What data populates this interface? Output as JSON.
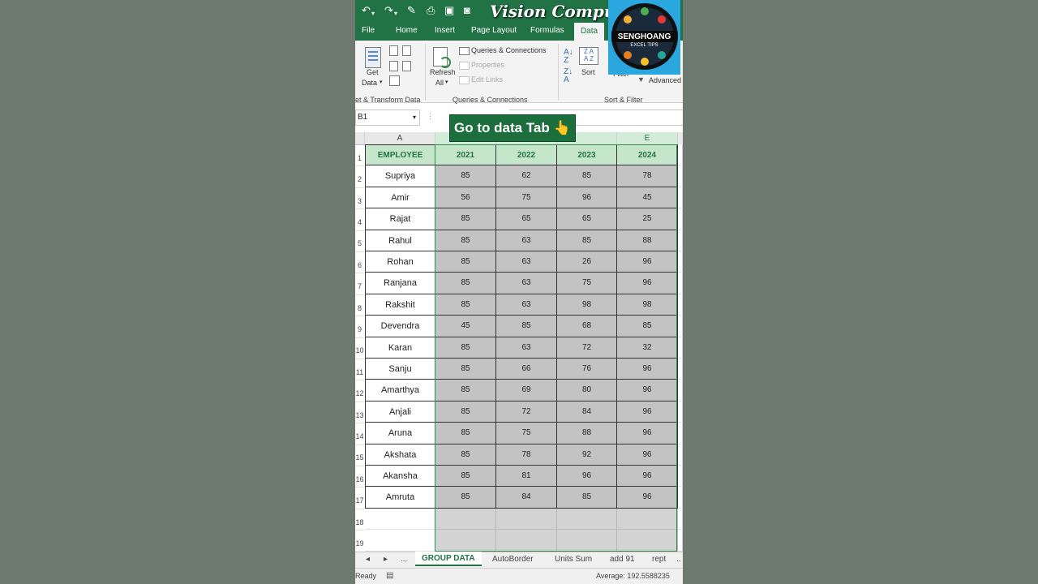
{
  "quick_access": {
    "undo": "↶",
    "redo": "↷"
  },
  "watermark": "Vision Compute",
  "ribbon_tabs": [
    {
      "label": "File"
    },
    {
      "label": "Home"
    },
    {
      "label": "Insert"
    },
    {
      "label": "Page Layout"
    },
    {
      "label": "Formulas"
    },
    {
      "label": "Data",
      "active": true
    }
  ],
  "ribbon": {
    "get_data_line1": "Get",
    "get_data_line2": "Data",
    "refresh_line1": "Refresh",
    "refresh_line2": "All",
    "queries_connections": "Queries & Connections",
    "properties": "Properties",
    "edit_links": "Edit Links",
    "sort": "Sort",
    "filter": "Filter",
    "advanced": "Advanced",
    "group_get_transform": "et & Transform Data",
    "group_queries": "Queries & Connections",
    "group_sort_filter": "Sort & Filter"
  },
  "name_box": "B1",
  "tooltip": "Go to data Tab 👆",
  "columns": {
    "a": "A",
    "e": "E"
  },
  "table": {
    "headers": [
      "EMPLOYEE",
      "2021",
      "2022",
      "2023",
      "2024"
    ],
    "rows": [
      [
        "Supriya",
        "85",
        "62",
        "85",
        "78"
      ],
      [
        "Amir",
        "56",
        "75",
        "96",
        "45"
      ],
      [
        "Rajat",
        "85",
        "65",
        "65",
        "25"
      ],
      [
        "Rahul",
        "85",
        "63",
        "85",
        "88"
      ],
      [
        "Rohan",
        "85",
        "63",
        "26",
        "96"
      ],
      [
        "Ranjana",
        "85",
        "63",
        "75",
        "96"
      ],
      [
        "Rakshit",
        "85",
        "63",
        "98",
        "98"
      ],
      [
        "Devendra",
        "45",
        "85",
        "68",
        "85"
      ],
      [
        "Karan",
        "85",
        "63",
        "72",
        "32"
      ],
      [
        "Sanju",
        "85",
        "66",
        "76",
        "96"
      ],
      [
        "Amarthya",
        "85",
        "69",
        "80",
        "96"
      ],
      [
        "Anjali",
        "85",
        "72",
        "84",
        "96"
      ],
      [
        "Aruna",
        "85",
        "75",
        "88",
        "96"
      ],
      [
        "Akshata",
        "85",
        "78",
        "92",
        "96"
      ],
      [
        "Akansha",
        "85",
        "81",
        "96",
        "96"
      ],
      [
        "Amruta",
        "85",
        "84",
        "85",
        "96"
      ]
    ]
  },
  "row_numbers": [
    "1",
    "2",
    "3",
    "4",
    "5",
    "6",
    "7",
    "8",
    "9",
    "10",
    "11",
    "12",
    "13",
    "14",
    "15",
    "16",
    "17",
    "18",
    "19"
  ],
  "sheet_tabs": [
    {
      "label": "GROUP DATA",
      "active": true
    },
    {
      "label": "AutoBorder"
    },
    {
      "label": "Units Sum"
    },
    {
      "label": "add 91"
    },
    {
      "label": "rept"
    }
  ],
  "sheet_nav": {
    "prev": "◂",
    "next": "▸",
    "more": "..."
  },
  "status": {
    "ready": "Ready",
    "average": "Average: 192.5588235"
  },
  "logo": {
    "name": "SENGHOANG",
    "sub": "EXCEL TIPS"
  },
  "colors": {
    "excel_green": "#217346",
    "selection": "#c3c3c3",
    "header_fill": "#c6e6cb"
  }
}
